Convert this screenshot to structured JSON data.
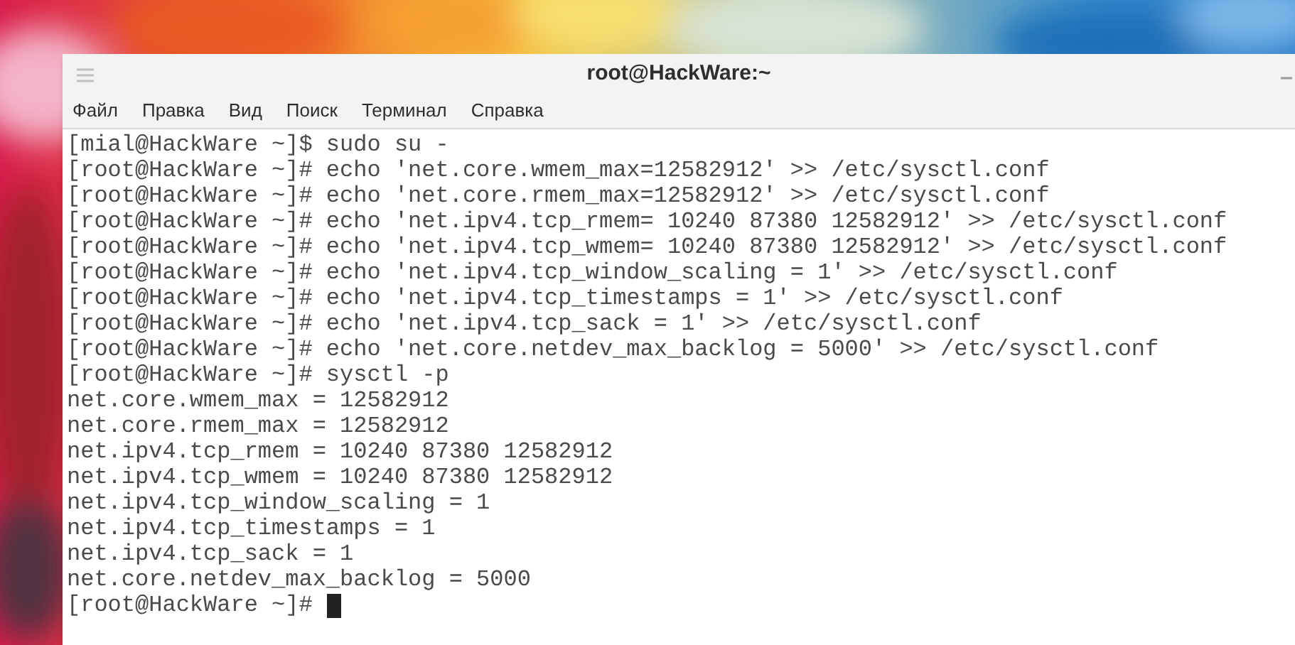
{
  "window": {
    "title": "root@HackWare:~"
  },
  "menu": [
    "Файл",
    "Правка",
    "Вид",
    "Поиск",
    "Терминал",
    "Справка"
  ],
  "terminal": {
    "lines": [
      "[mial@HackWare ~]$ sudo su -",
      "[root@HackWare ~]# echo 'net.core.wmem_max=12582912' >> /etc/sysctl.conf",
      "[root@HackWare ~]# echo 'net.core.rmem_max=12582912' >> /etc/sysctl.conf",
      "[root@HackWare ~]# echo 'net.ipv4.tcp_rmem= 10240 87380 12582912' >> /etc/sysctl.conf",
      "[root@HackWare ~]# echo 'net.ipv4.tcp_wmem= 10240 87380 12582912' >> /etc/sysctl.conf",
      "[root@HackWare ~]# echo 'net.ipv4.tcp_window_scaling = 1' >> /etc/sysctl.conf",
      "[root@HackWare ~]# echo 'net.ipv4.tcp_timestamps = 1' >> /etc/sysctl.conf",
      "[root@HackWare ~]# echo 'net.ipv4.tcp_sack = 1' >> /etc/sysctl.conf",
      "[root@HackWare ~]# echo 'net.core.netdev_max_backlog = 5000' >> /etc/sysctl.conf",
      "[root@HackWare ~]# sysctl -p",
      "net.core.wmem_max = 12582912",
      "net.core.rmem_max = 12582912",
      "net.ipv4.tcp_rmem = 10240 87380 12582912",
      "net.ipv4.tcp_wmem = 10240 87380 12582912",
      "net.ipv4.tcp_window_scaling = 1",
      "net.ipv4.tcp_timestamps = 1",
      "net.ipv4.tcp_sack = 1",
      "net.core.netdev_max_backlog = 5000"
    ],
    "prompt": "[root@HackWare ~]#"
  }
}
